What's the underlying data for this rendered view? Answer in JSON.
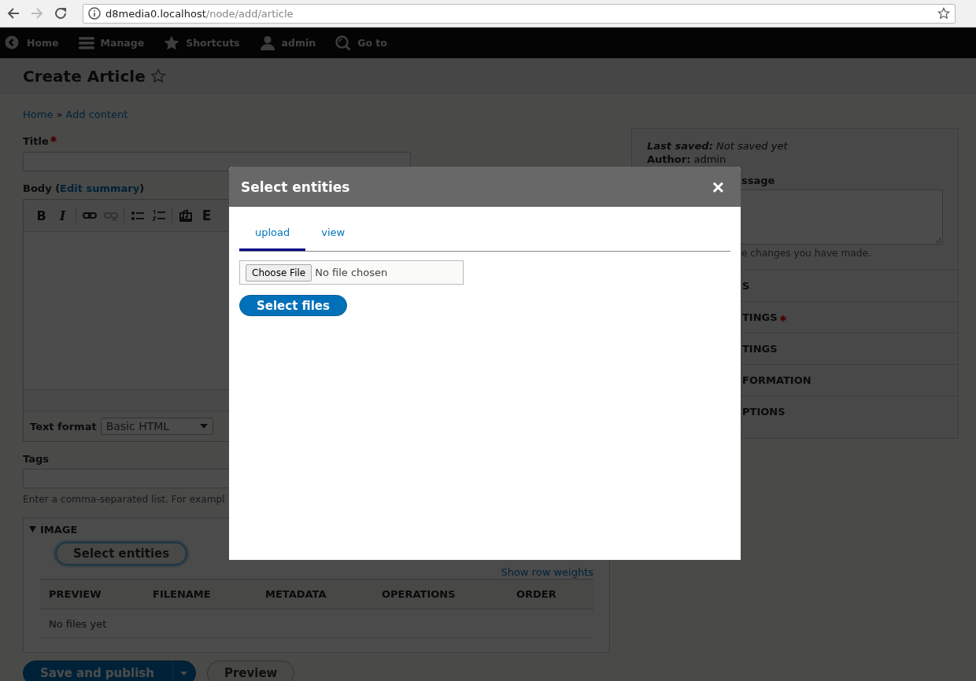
{
  "browser": {
    "url_host": "d8media0.localhost",
    "url_path": "/node/add/article"
  },
  "toolbar": {
    "items": [
      {
        "label": "Home",
        "kind": "back"
      },
      {
        "label": "Manage",
        "kind": "menu"
      },
      {
        "label": "Shortcuts",
        "kind": "star"
      },
      {
        "label": "admin",
        "kind": "person"
      },
      {
        "label": "Go to",
        "kind": "search"
      }
    ]
  },
  "page_title": "Create Article",
  "breadcrumb": {
    "items": [
      {
        "label": "Home"
      },
      {
        "label": "Add content"
      }
    ],
    "separator": "»"
  },
  "form": {
    "title_label": "Title",
    "title_required": true,
    "body_label": "Body (",
    "body_link": "Edit summary",
    "body_label_end": ")",
    "editor_groups": [
      [
        {
          "kind": "bold",
          "glyph": "B",
          "disabled": false
        },
        {
          "kind": "italic",
          "glyph": "I",
          "disabled": false
        }
      ],
      [
        {
          "kind": "link",
          "disabled": false
        },
        {
          "kind": "unlink",
          "disabled": true
        }
      ],
      [
        {
          "kind": "bullets",
          "disabled": false
        },
        {
          "kind": "numbers",
          "disabled": false
        }
      ],
      [
        {
          "kind": "media",
          "disabled": false
        },
        {
          "kind": "embed",
          "glyph": "E",
          "disabled": false
        }
      ]
    ],
    "text_format_label": "Text format",
    "text_format_value": "Basic HTML",
    "tags_label": "Tags",
    "tags_help": "Enter a comma-separated list. For exampl",
    "image": {
      "legend": "IMAGE",
      "expanded": true,
      "button": "Select entities",
      "weights_link": "Show row weights",
      "columns": [
        "PREVIEW",
        "FILENAME",
        "METADATA",
        "OPERATIONS",
        "ORDER"
      ],
      "empty": "No files yet"
    },
    "actions": [
      {
        "label": "Save and publish",
        "kind": "primary"
      },
      {
        "label": "Preview",
        "kind": "secondary"
      }
    ]
  },
  "sidebar": {
    "last_saved": "**Last saved:** Not saved yet",
    "author": "**Author:** admin",
    "revision_label": "ssage",
    "revision_help": "e changes you have made.",
    "sections": [
      {
        "label": "S",
        "required": false
      },
      {
        "label": "TINGS",
        "required": true
      },
      {
        "label": "TINGS",
        "required": false
      },
      {
        "label": "FORMATION",
        "required": false
      },
      {
        "label": "PTIONS",
        "required": false
      }
    ]
  },
  "dialog": {
    "title": "Select entities",
    "close": "×",
    "tabs": [
      {
        "label": "upload",
        "selected": true
      },
      {
        "label": "view",
        "selected": false
      }
    ],
    "file_button": "Choose File",
    "file_status": "No file chosen",
    "submit": "Select files"
  }
}
